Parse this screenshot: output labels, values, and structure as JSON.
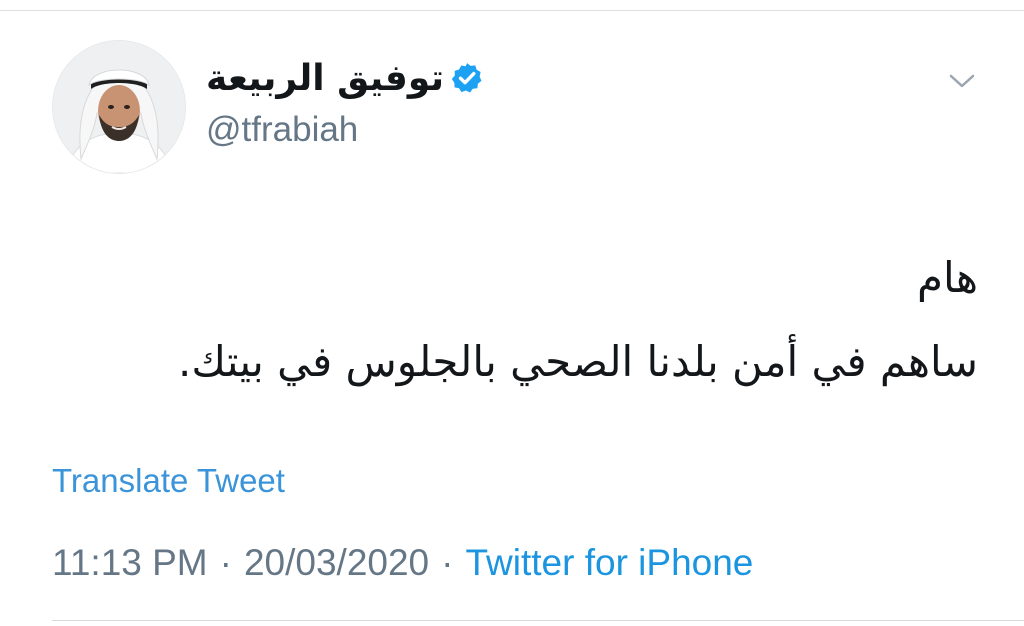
{
  "tweet": {
    "author": {
      "display_name": "توفيق الربيعة",
      "username": "@tfrabiah",
      "verified": true,
      "avatar_icon": "profile-photo"
    },
    "text_lines": [
      "هام",
      "ساهم في أمن بلدنا الصحي بالجلوس في بيتك."
    ],
    "translate_label": "Translate Tweet",
    "time": "11:13 PM",
    "date": "20/03/2020",
    "separator": "·",
    "source": "Twitter for iPhone",
    "menu_icon": "chevron-down-icon"
  },
  "colors": {
    "text": "#14171a",
    "secondary_text": "#657786",
    "link": "#1b95e0",
    "verified_badge": "#1da1f2",
    "divider": "#dcdfe2"
  }
}
